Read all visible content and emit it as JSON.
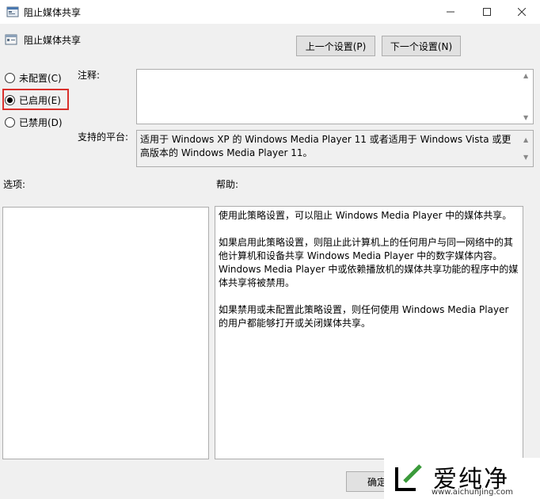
{
  "window": {
    "title": "阻止媒体共享"
  },
  "header": {
    "policy_name": "阻止媒体共享",
    "prev_label": "上一个设置(P)",
    "next_label": "下一个设置(N)"
  },
  "state": {
    "options": [
      {
        "label": "未配置(C)",
        "checked": false
      },
      {
        "label": "已启用(E)",
        "checked": true
      },
      {
        "label": "已禁用(D)",
        "checked": false
      }
    ]
  },
  "labels": {
    "comment": "注释:",
    "platform": "支持的平台:",
    "options": "选项:",
    "help": "帮助:"
  },
  "platform_text": "适用于 Windows XP 的 Windows Media Player 11 或者适用于 Windows Vista 或更高版本的 Windows Media Player 11。",
  "help": {
    "paragraphs": [
      "使用此策略设置，可以阻止 Windows Media Player 中的媒体共享。",
      "如果启用此策略设置，则阻止此计算机上的任何用户与同一网络中的其他计算机和设备共享 Windows Media Player 中的数字媒体内容。Windows Media Player 中或依赖播放机的媒体共享功能的程序中的媒体共享将被禁用。",
      "如果禁用或未配置此策略设置，则任何使用 Windows Media Player 的用户都能够打开或关闭媒体共享。"
    ]
  },
  "footer": {
    "ok_label": "确定"
  },
  "watermark": {
    "brand": "爱纯净",
    "url": "www.aichunjing.com"
  },
  "colors": {
    "highlight": "#d9302c"
  }
}
